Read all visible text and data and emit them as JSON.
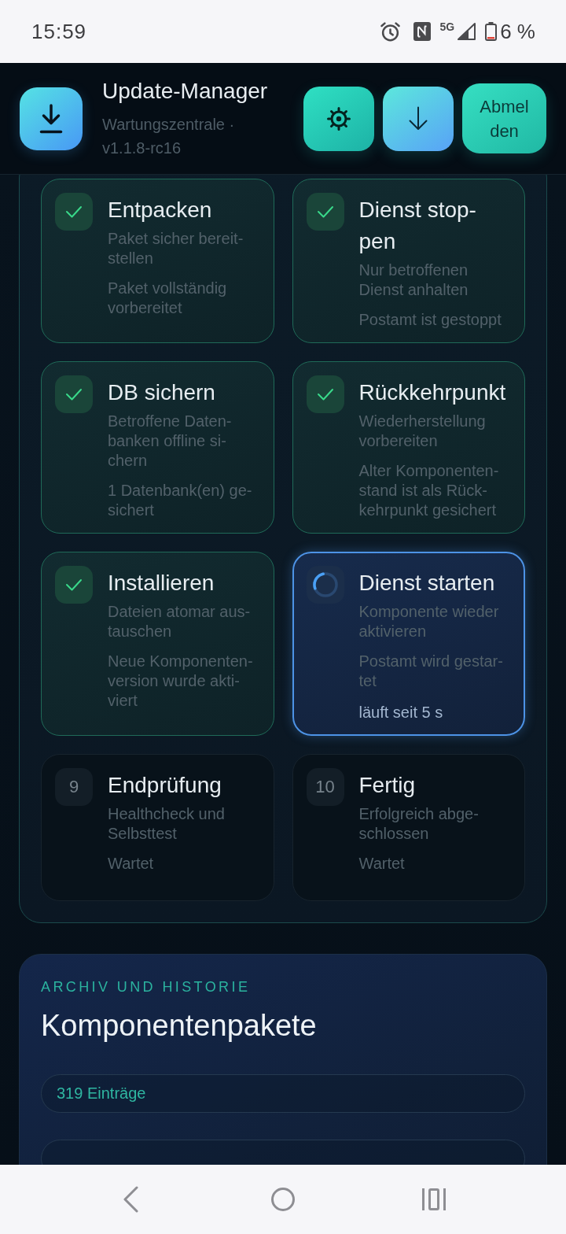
{
  "status_bar": {
    "time": "15:59",
    "network_type": "5G",
    "battery": "6 %"
  },
  "header": {
    "title": "Update-Manager",
    "subtitle": "Wartungszentrale · v1.1.8-rc16",
    "actions": [
      {
        "kind": "settings"
      },
      {
        "kind": "download"
      },
      {
        "kind": "logout",
        "label": "Abmelden"
      }
    ]
  },
  "steps": [
    {
      "kind": "done",
      "title": "Entpacken",
      "description": "Paket sicher bereit-stellen",
      "result": "Paket vollständig vorbereitet"
    },
    {
      "kind": "done",
      "title": "Dienst stop-pen",
      "description": "Nur betroffenen Dienst anhalten",
      "result": "Postamt ist gestoppt"
    },
    {
      "kind": "done",
      "title": "DB sichern",
      "description": "Betroffene Daten-banken offline si-chern",
      "result": "1 Datenbank(en) ge-sichert"
    },
    {
      "kind": "done",
      "title": "Rückkehrpunkt",
      "description": "Wiederherstellung vorbereiten",
      "result": "Alter Komponenten-stand ist als Rück-kehrpunkt gesichert"
    },
    {
      "kind": "done",
      "title": "Installieren",
      "description": "Dateien atomar aus-tauschen",
      "result": "Neue Komponenten-version wurde akti-viert"
    },
    {
      "kind": "running",
      "title": "Dienst starten",
      "description": "Komponente wieder aktivieren",
      "result": "Postamt wird gestar-tet",
      "elapsed": "läuft seit 5 s"
    },
    {
      "kind": "pending",
      "number": "9",
      "title": "Endprüfung",
      "description": "Healthcheck und Selbsttest",
      "result": "Wartet"
    },
    {
      "kind": "pending",
      "number": "10",
      "title": "Fertig",
      "description": "Erfolgreich abge-schlossen",
      "result": "Wartet"
    }
  ],
  "archive": {
    "eyebrow": "ARCHIV UND HISTORIE",
    "title": "Komponentenpakete",
    "count": "319 Einträge"
  }
}
